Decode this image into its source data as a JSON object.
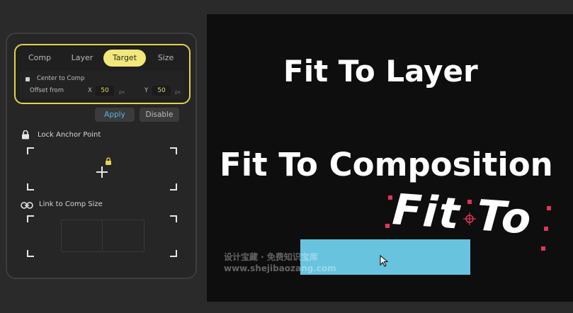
{
  "panel": {
    "tabs": [
      {
        "label": "Comp",
        "active": false
      },
      {
        "label": "Layer",
        "active": false
      },
      {
        "label": "Target",
        "active": true
      },
      {
        "label": "Size",
        "active": false
      }
    ],
    "center_to_comp": "Center to Comp",
    "offset_from": "Offset from",
    "x_label": "X",
    "x_value": "50",
    "x_unit": "px",
    "y_label": "Y",
    "y_value": "50",
    "y_unit": "px",
    "apply_label": "Apply",
    "disable_label": "Disable",
    "lock_anchor_label": "Lock Anchor Point",
    "link_comp_label": "Link to Comp Size"
  },
  "preview": {
    "line1": "Fit To Layer",
    "line2": "Fit To Composition",
    "animated_text": "Fit To"
  },
  "watermark": {
    "line1": "设计宝藏 · 免费知识宝库",
    "line2": "www.shejibaozang.com"
  },
  "colors": {
    "accent_yellow": "#e2d24d",
    "apply_blue": "#58b5e8",
    "handle_red": "#e0355a",
    "preview_rect": "#68c3df"
  }
}
